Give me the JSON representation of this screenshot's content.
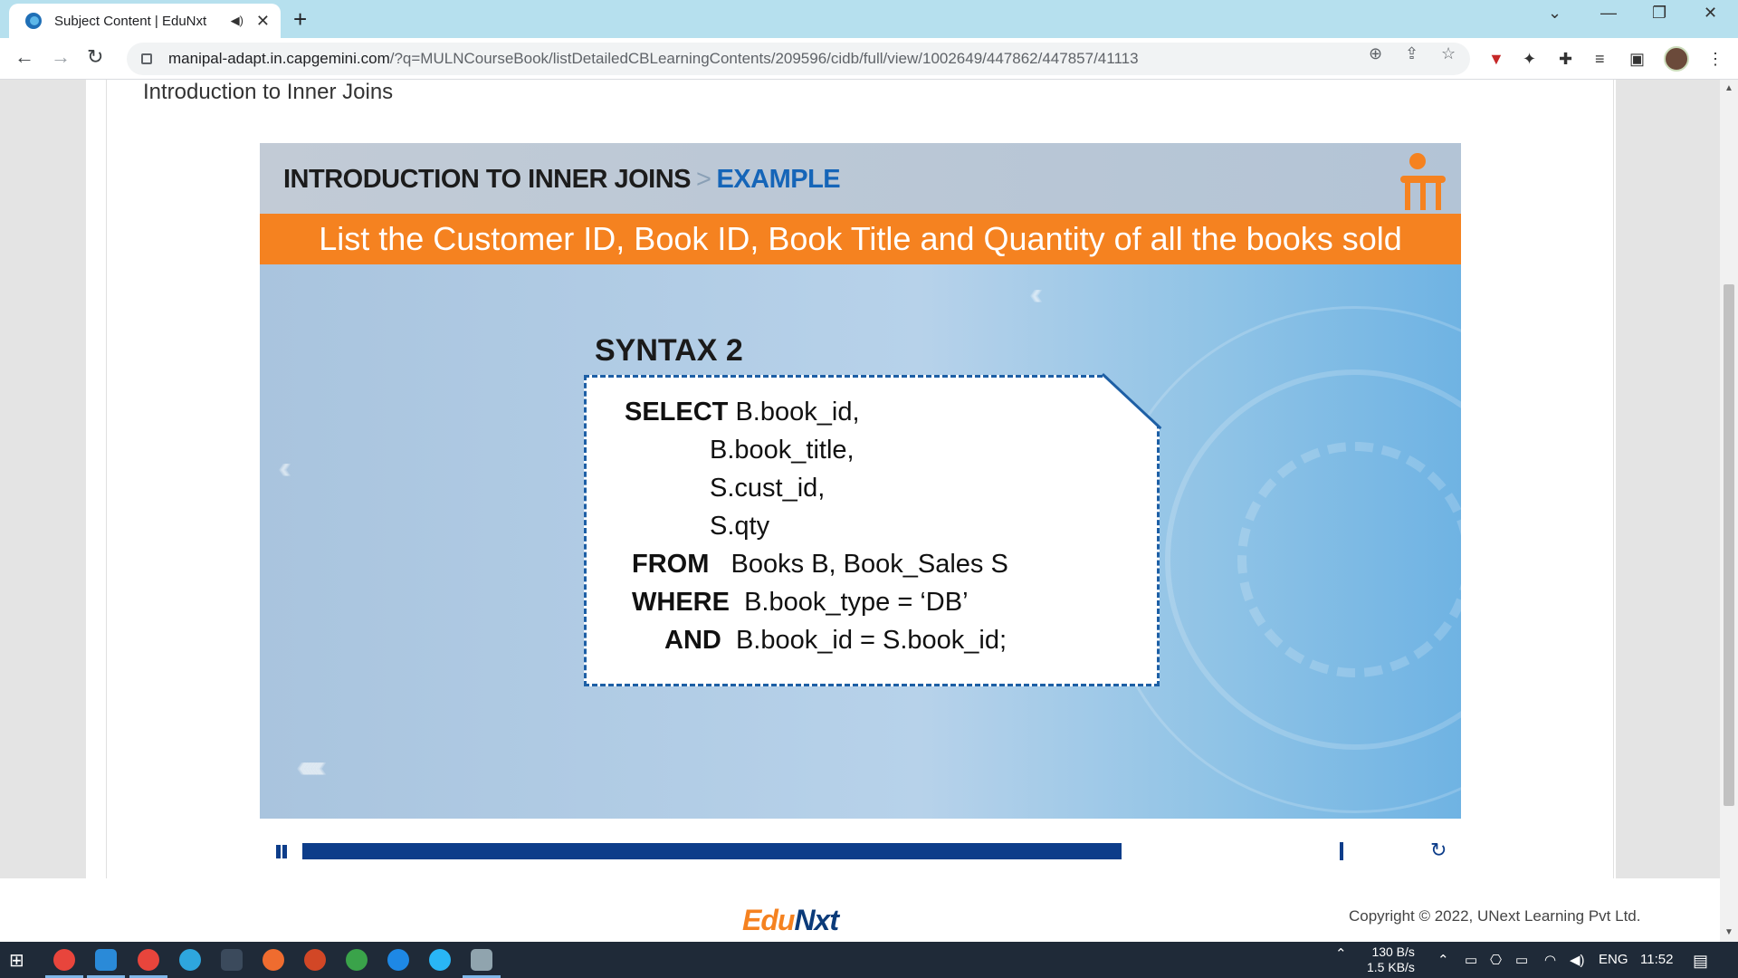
{
  "browser": {
    "tab_title": "Subject Content | EduNxt",
    "audio_icon": "speaker-icon",
    "url_host": "manipal-adapt.in.capgemini.com",
    "url_path": "/?q=MULNCourseBook/listDetailedCBLearningContents/209596/cidb/full/view/1002649/447862/447857/41113"
  },
  "page": {
    "content_title": "Introduction to Inner Joins"
  },
  "video": {
    "header_main": "INTRODUCTION TO INNER JOINS",
    "header_sep": ">",
    "header_accent": "EXAMPLE",
    "banner": "List the Customer ID, Book ID, Book Title and Quantity of all the books sold",
    "syntax_heading": "SYNTAX 2",
    "code": {
      "select_kw": "SELECT",
      "l1": "B.book_id,",
      "l2": "B.book_title,",
      "l3": "S.cust_id,",
      "l4": "S.qty",
      "from_kw": "FROM",
      "from_val": "Books B, Book_Sales S",
      "where_kw": "WHERE",
      "where_val": "B.book_type = ‘DB’",
      "and_kw": "AND",
      "and_val": "B.book_id = S.book_id;"
    },
    "progress_fraction": 0.79
  },
  "footer": {
    "logo_edu": "Edu",
    "logo_nxt": "Nxt",
    "copyright": "Copyright © 2022, UNext Learning Pvt Ltd."
  },
  "taskbar": {
    "net_up": "130 B/s",
    "net_down": "1.5 KB/s",
    "lang": "ENG",
    "time": "11:52"
  },
  "colors": {
    "accent_orange": "#f58220",
    "accent_blue": "#1565b8",
    "player_blue": "#0d3d8a"
  }
}
